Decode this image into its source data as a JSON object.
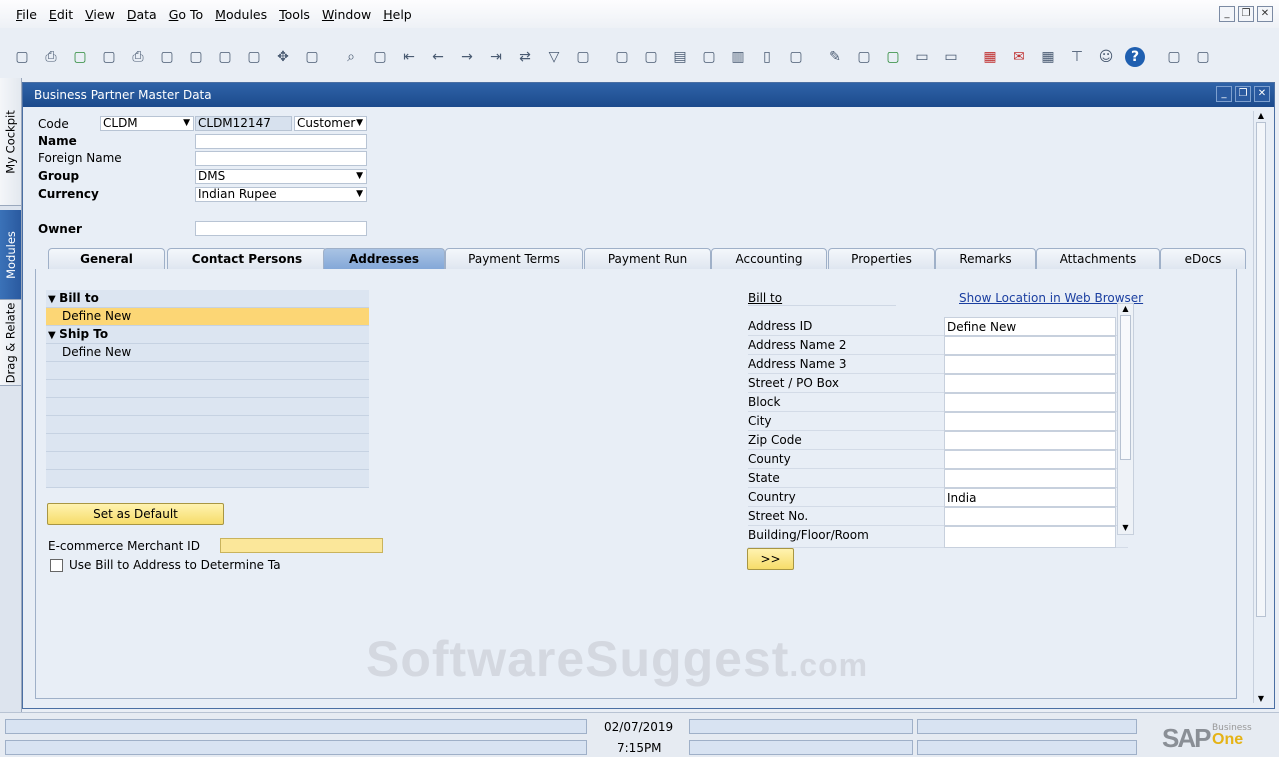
{
  "menu": [
    "File",
    "Edit",
    "View",
    "Data",
    "Go To",
    "Modules",
    "Tools",
    "Window",
    "Help"
  ],
  "toolbar": [
    "preview-icon",
    "print-icon",
    "export-excel-icon",
    "send-icon",
    "printer-icon",
    "export-icon",
    "doc-icon",
    "doc2-icon",
    "pdf-icon",
    "move-icon",
    "form-settings-icon",
    "|",
    "find-icon",
    "add-icon",
    "first-record-icon",
    "previous-record-icon",
    "next-record-icon",
    "last-record-icon",
    "refresh-icon",
    "filter-icon",
    "sort-icon",
    "|",
    "base-doc-icon",
    "target-doc-icon",
    "report-icon",
    "gross-profit-icon",
    "chart-icon",
    "journal-icon",
    "query-icon",
    "|",
    "edit-icon",
    "new-doc-icon",
    "approve-icon",
    "message-icon",
    "chat-icon",
    "|",
    "calendar-alert-icon",
    "mail-alert-icon",
    "calendar-icon",
    "org-icon",
    "user-icon",
    "help-icon",
    "|",
    "settings-icon",
    "layout-icon"
  ],
  "sidetabs": [
    "My Cockpit",
    "Modules",
    "Drag & Relate"
  ],
  "window": {
    "title": "Business Partner Master Data"
  },
  "header": {
    "code_label": "Code",
    "code_series": "CLDM",
    "code_value": "CLDM12147",
    "bp_type": "Customer",
    "name_label": "Name",
    "name_value": "",
    "foreign_name_label": "Foreign Name",
    "foreign_name_value": "",
    "group_label": "Group",
    "group_value": "DMS",
    "currency_label": "Currency",
    "currency_value": "Indian Rupee",
    "owner_label": "Owner",
    "owner_value": ""
  },
  "tabs": [
    "General",
    "Contact Persons",
    "Addresses",
    "Payment Terms",
    "Payment Run",
    "Accounting",
    "Properties",
    "Remarks",
    "Attachments",
    "eDocs"
  ],
  "active_tab": "Addresses",
  "tree": [
    {
      "label": "Bill to",
      "type": "header"
    },
    {
      "label": "Define New",
      "type": "selected"
    },
    {
      "label": "Ship To",
      "type": "header"
    },
    {
      "label": "Define New",
      "type": "item"
    }
  ],
  "set_default": "Set as Default",
  "ecommerce_label": "E-commerce Merchant ID",
  "ecommerce_value": "",
  "use_bill_to": "Use Bill to Address to Determine Ta",
  "address": {
    "section": "Bill to",
    "show_location": "Show Location in Web Browser",
    "fields": [
      {
        "label": "Address ID",
        "value": "Define New"
      },
      {
        "label": "Address Name 2",
        "value": ""
      },
      {
        "label": "Address Name 3",
        "value": ""
      },
      {
        "label": "Street / PO Box",
        "value": ""
      },
      {
        "label": "Block",
        "value": ""
      },
      {
        "label": "City",
        "value": ""
      },
      {
        "label": "Zip Code",
        "value": ""
      },
      {
        "label": "County",
        "value": ""
      },
      {
        "label": "State",
        "value": ""
      },
      {
        "label": "Country",
        "value": "India"
      },
      {
        "label": "Street No.",
        "value": ""
      },
      {
        "label": "Building/Floor/Room",
        "value": ""
      }
    ],
    "more_button": ">>"
  },
  "status": {
    "date": "02/07/2019",
    "time": "7:15PM"
  },
  "logo": {
    "sap": "SAP",
    "business": "Business",
    "one": "One"
  },
  "watermark": {
    "main": "SoftwareSuggest",
    "suffix": ".com"
  }
}
